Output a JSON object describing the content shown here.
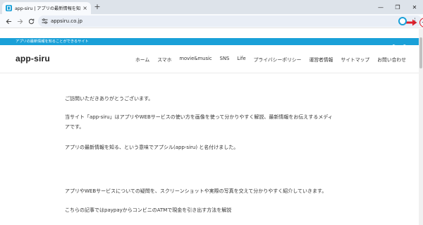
{
  "browser": {
    "tab": {
      "title": "app-siru | アプリの最新情報を知る",
      "close_glyph": "×"
    },
    "new_tab_glyph": "+",
    "window_controls": {
      "minimize": "—",
      "restore": "❐",
      "close": "✕"
    },
    "url": "appsiru.co.jp",
    "accent_color": "#1aa0d8",
    "highlight_color": "#e0202a"
  },
  "site": {
    "tagline": "アプリの最新情報を知ることができるサイト",
    "logo": "app-siru",
    "nav": [
      "ホーム",
      "スマホ",
      "movie&music",
      "SNS",
      "Life",
      "プライバシーポリシー",
      "運営者情報",
      "サイトマップ",
      "お問い合わせ"
    ]
  },
  "content": {
    "paragraphs": [
      "ご訪問いただきありがとうございます。",
      "当サイト「app-siru」はアプリやWEBサービスの使い方を画像を使って分かりやすく解説、最新情報をお伝えするメディ",
      "アです。",
      "アプリの最新情報を知る、という意味でアプシル(app-siru) と名付けました。",
      "アプリやWEBサービスについての疑問を、スクリーンショットや実際の写真を交えて分かりやすく紹介していきます。",
      "こちらの記事ではpaypayからコンビニのATMで現金を引き出す方法を解説"
    ]
  }
}
